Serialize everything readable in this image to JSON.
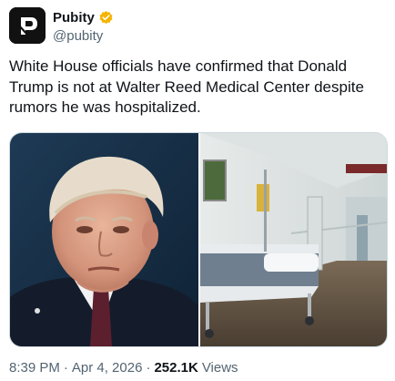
{
  "author": {
    "display_name": "Pubity",
    "handle": "@pubity",
    "verified": true,
    "verified_color": "#f4b400",
    "avatar_icon": "pubity-logo-icon"
  },
  "tweet": {
    "text": "White House officials have confirmed that Donald Trump is not at Walter Reed Medical Center despite rumors he was hospitalized."
  },
  "media": [
    {
      "icon": "portrait-photo"
    },
    {
      "icon": "hospital-corridor-photo"
    }
  ],
  "meta": {
    "time": "8:39 PM",
    "separator": "·",
    "date": "Apr 4, 2026",
    "views_count": "252.1K",
    "views_label": "Views"
  }
}
